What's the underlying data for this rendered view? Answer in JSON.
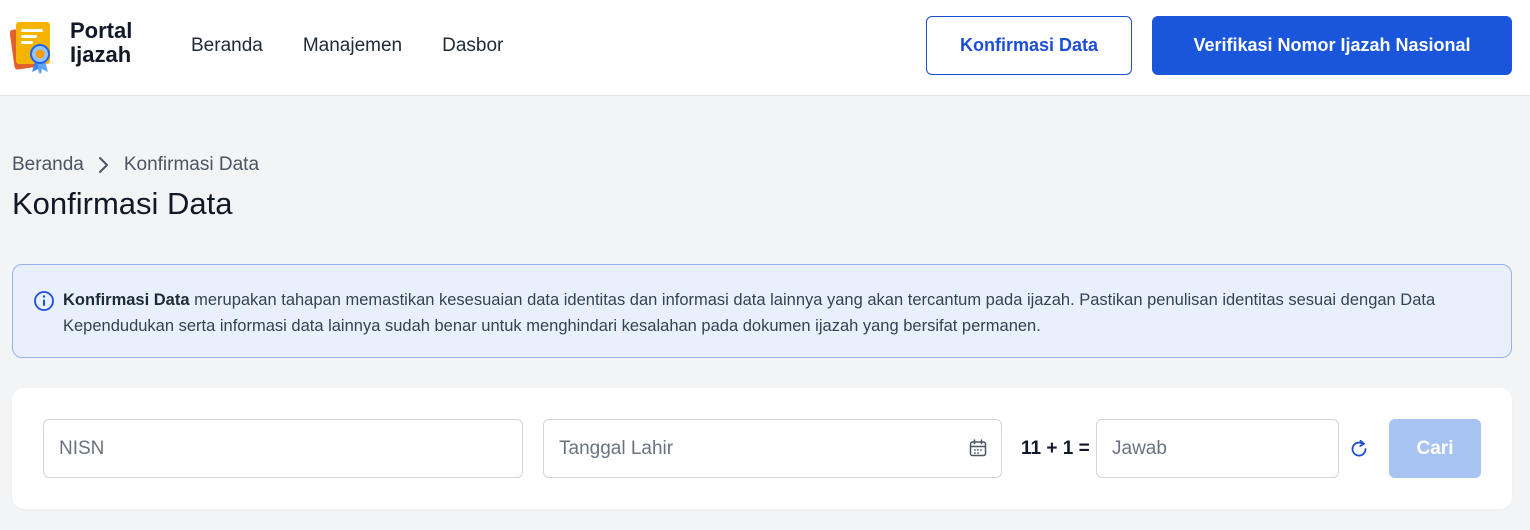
{
  "header": {
    "brand_line1": "Portal",
    "brand_line2": "Ijazah",
    "nav": [
      "Beranda",
      "Manajemen",
      "Dasbor"
    ],
    "btn_konfirmasi": "Konfirmasi Data",
    "btn_verifikasi": "Verifikasi Nomor Ijazah Nasional"
  },
  "breadcrumb": {
    "home": "Beranda",
    "current": "Konfirmasi Data"
  },
  "page_title": "Konfirmasi Data",
  "alert": {
    "bold": "Konfirmasi Data",
    "text": " merupakan tahapan memastikan kesesuaian data identitas dan informasi data lainnya yang akan tercantum pada ijazah. Pastikan penulisan identitas sesuai dengan Data Kependudukan serta informasi data lainnya sudah benar untuk menghindari kesalahan pada dokumen ijazah yang bersifat permanen."
  },
  "search": {
    "nisn_placeholder": "NISN",
    "nisn_value": "",
    "tgl_placeholder": "Tanggal Lahir",
    "tgl_value": "",
    "captcha_question": "11 + 1 =",
    "jawab_placeholder": "Jawab",
    "jawab_value": "",
    "btn_cari": "Cari"
  },
  "colors": {
    "primary": "#1a56db",
    "primary_disabled": "#a7c3f2",
    "alert_bg": "#e8f0fe",
    "alert_border": "#93b4f0",
    "page_bg": "#f3f4f6"
  },
  "icons": {
    "logo": "ijazah-certificate-logo",
    "breadcrumb_separator": "chevron-right-icon",
    "info": "info-circle-icon",
    "calendar": "calendar-icon",
    "refresh": "refresh-icon"
  }
}
